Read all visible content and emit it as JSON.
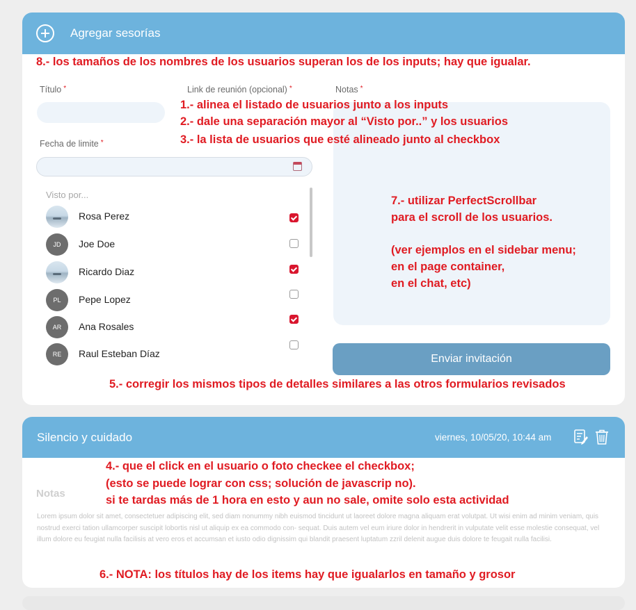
{
  "card1": {
    "title": "Agregar sesorías",
    "annotation_8": "8.- los tamaños de los nombres de los usuarios superan los de los inputs; hay que igualar.",
    "label_titulo": "Título",
    "label_link": "Link de reunión (opcional)",
    "label_notas": "Notas",
    "label_fecha": "Fecha de limite",
    "required_mark": "*",
    "annotation_1": "1.- alinea el listado de usuarios junto a los inputs",
    "annotation_2": "2.- dale una separación mayor al “Visto por..” y los usuarios",
    "annotation_3": "3.- la lista de usuarios que esté alineado junto al checkbox",
    "visto_por": "Visto por...",
    "users": [
      {
        "name": "Rosa Perez",
        "initials": "",
        "photo": true,
        "checked": true
      },
      {
        "name": "Joe Doe",
        "initials": "JD",
        "photo": false,
        "checked": false
      },
      {
        "name": "Ricardo Diaz",
        "initials": "",
        "photo": true,
        "checked": true
      },
      {
        "name": "Pepe Lopez",
        "initials": "PL",
        "photo": false,
        "checked": false
      },
      {
        "name": "Ana Rosales",
        "initials": "AR",
        "photo": false,
        "checked": true
      },
      {
        "name": "Raul Esteban Díaz",
        "initials": "RE",
        "photo": false,
        "checked": false
      }
    ],
    "annotation_7": [
      "7.- utilizar PerfectScrollbar",
      "para el scroll de los usuarios.",
      "",
      "(ver ejemplos en el sidebar menu;",
      "en el page container,",
      "en el chat, etc)"
    ],
    "send_button": "Enviar invitación",
    "annotation_5": "5.- corregir los mismos tipos de detalles similares a las otros formularios revisados"
  },
  "card2": {
    "title": "Silencio y cuidado",
    "date": "viernes, 10/05/20, 10:44 am",
    "annotation_4": [
      "4.- que el click en el usuario o foto checkee el checkbox;",
      "(esto se puede lograr con css; solución de javascrip no).",
      "si te tardas más de 1 hora en esto y aun no sale, omite solo esta actividad"
    ],
    "notas_title": "Notas",
    "lorem": "Lorem ipsum dolor sit amet, consectetuer adipiscing elit, sed diam nonummy nibh euismod tincidunt ut laoreet dolore magna aliquam erat volutpat. Ut wisi enim ad minim veniam, quis nostrud exerci tation ullamcorper suscipit lobortis nisl ut aliquip ex ea commodo con- sequat. Duis autem vel eum iriure dolor in hendrerit in vulputate velit esse molestie consequat, vel illum dolore eu feugiat nulla facilisis at vero eros et accumsan et iusto odio dignissim qui blandit praesent luptatum zzril delenit augue duis dolore te feugait nulla facilisi.",
    "annotation_6": "6.- NOTA: los títulos hay de los items hay que igualarlos en tamaño y grosor"
  },
  "colors": {
    "header": "#6db3dd",
    "button": "#6a9fc3",
    "annotation": "#e01b22",
    "checkbox_on": "#d9162e"
  }
}
